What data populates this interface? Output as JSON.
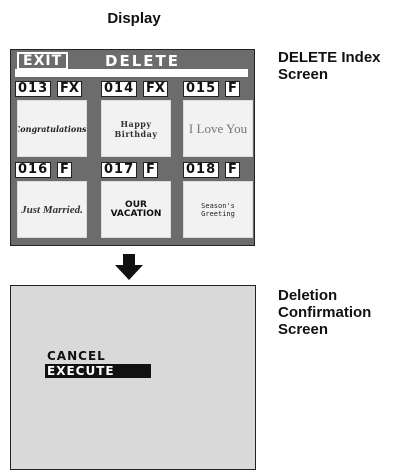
{
  "heading": "Display",
  "captions": {
    "index_line1": "DELETE Index",
    "index_line2": "Screen",
    "confirm_line1": "Deletion",
    "confirm_line2": "Confirmation",
    "confirm_line3": "Screen"
  },
  "index_screen": {
    "exit_label": "EXIT",
    "title": "DELETE",
    "items": [
      {
        "number": "013",
        "tag": "FX",
        "title_text": "Congratulations!"
      },
      {
        "number": "014",
        "tag": "FX",
        "title_text": "Happy Birthday"
      },
      {
        "number": "015",
        "tag": "F",
        "title_text": "I Love You"
      },
      {
        "number": "016",
        "tag": "F",
        "title_text": "Just Married."
      },
      {
        "number": "017",
        "tag": "F",
        "title_text": "OUR VACATION"
      },
      {
        "number": "018",
        "tag": "F",
        "title_text": "Season's Greeting"
      }
    ]
  },
  "confirm_screen": {
    "cancel_label": "CANCEL",
    "execute_label": "EXECUTE"
  },
  "colors": {
    "index_background": "#6c6c6c",
    "confirm_background": "#d9d9d9",
    "highlight": "#111111"
  }
}
